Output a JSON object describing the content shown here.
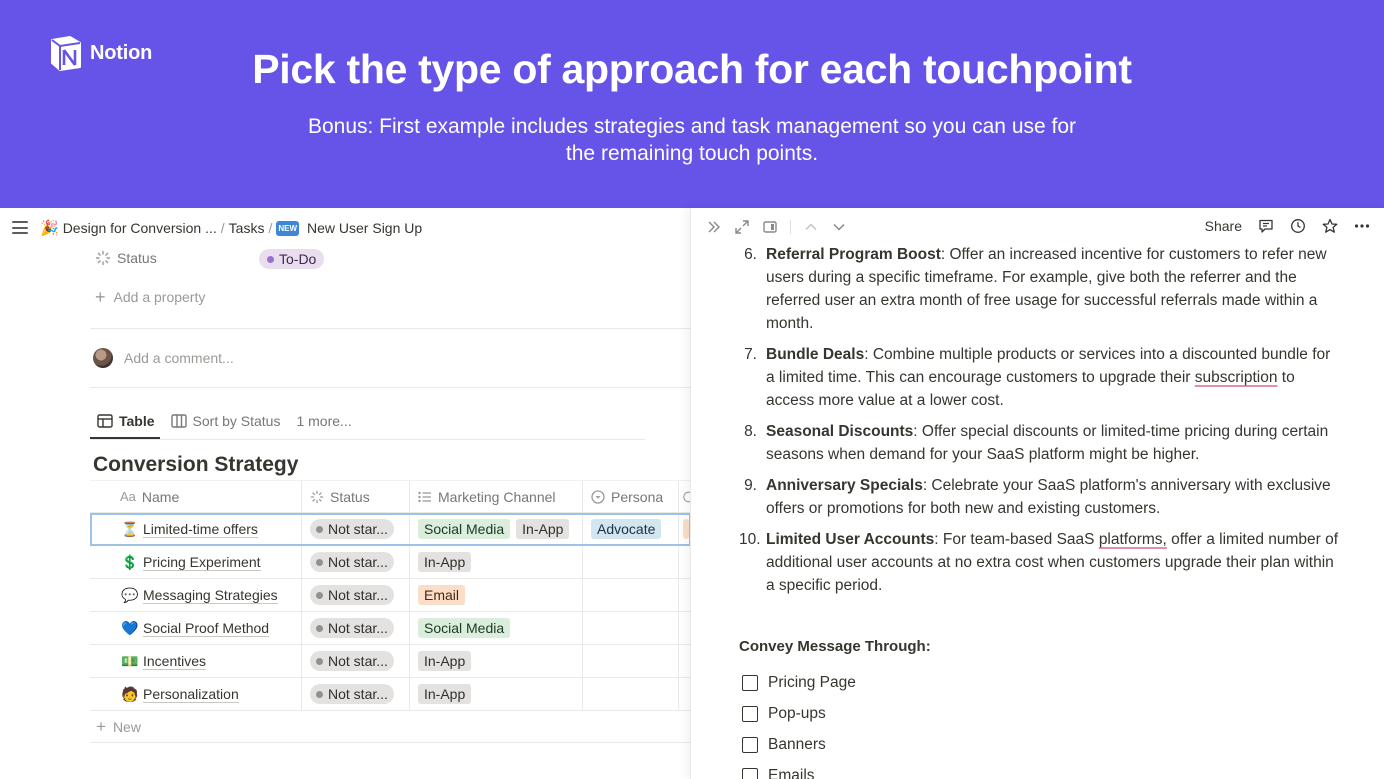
{
  "banner": {
    "brand": "Notion",
    "title": "Pick the type of approach for each touchpoint",
    "subtitle": "Bonus: First example includes strategies and task management so you can use for the remaining touch points."
  },
  "topbar": {
    "crumb1": "Design for Conversion ...",
    "crumb2": "Tasks",
    "crumb3_badge": "NEW",
    "crumb3": "New User Sign Up",
    "sep": "/"
  },
  "properties": {
    "status_label": "Status",
    "status_value": "To-Do",
    "add_property": "Add a property",
    "add_comment": "Add a comment..."
  },
  "views": {
    "table": "Table",
    "sort": "Sort by Status",
    "more": "1 more..."
  },
  "database": {
    "title": "Conversion Strategy",
    "columns": {
      "name": "Name",
      "status": "Status",
      "channel": "Marketing Channel",
      "persona": "Persona"
    },
    "new_label": "New",
    "rows": [
      {
        "emoji": "⏳",
        "name": "Limited-time offers",
        "status": "Not star...",
        "tags": [
          "Social Media",
          "In-App"
        ],
        "persona": "Advocate"
      },
      {
        "emoji": "💲",
        "name": "Pricing Experiment",
        "status": "Not star...",
        "tags": [
          "In-App"
        ],
        "persona": ""
      },
      {
        "emoji": "💬",
        "name": "Messaging Strategies",
        "status": "Not star...",
        "tags": [
          "Email"
        ],
        "persona": ""
      },
      {
        "emoji": "💙",
        "name": "Social Proof Method",
        "status": "Not star...",
        "tags": [
          "Social Media"
        ],
        "persona": ""
      },
      {
        "emoji": "💵",
        "name": "Incentives",
        "status": "Not star...",
        "tags": [
          "In-App"
        ],
        "persona": ""
      },
      {
        "emoji": "🧑",
        "name": "Personalization",
        "status": "Not star...",
        "tags": [
          "In-App"
        ],
        "persona": ""
      }
    ]
  },
  "peek": {
    "share": "Share",
    "items": [
      {
        "num": "6.",
        "title": "Referral Program Boost",
        "text": ": Offer an increased incentive for customers to refer new users during a specific timeframe. For example, give both the referrer and the referred user an extra month of free usage for successful referrals made within a month."
      },
      {
        "num": "7.",
        "title": "Bundle Deals",
        "text_a": ": Combine multiple products or services into a discounted bundle for a limited time. This can encourage customers to upgrade their ",
        "text_sq": "subscription",
        "text_b": " to access more value at a lower cost."
      },
      {
        "num": "8.",
        "title": "Seasonal Discounts",
        "text": ": Offer special discounts or limited-time pricing during certain seasons when demand for your SaaS platform might be higher."
      },
      {
        "num": "9.",
        "title": "Anniversary Specials",
        "text": ": Celebrate your SaaS platform's anniversary with exclusive offers or promotions for both new and existing customers."
      },
      {
        "num": "10.",
        "title": "Limited User Accounts",
        "text_a": ": For team-based SaaS ",
        "text_sq": "platforms,",
        "text_b": " offer a limited number of additional user accounts at no extra cost when customers upgrade their plan within a specific period."
      }
    ],
    "convey_heading": "Convey Message Through:",
    "todos": [
      "Pricing Page",
      "Pop-ups",
      "Banners",
      "Emails"
    ]
  }
}
